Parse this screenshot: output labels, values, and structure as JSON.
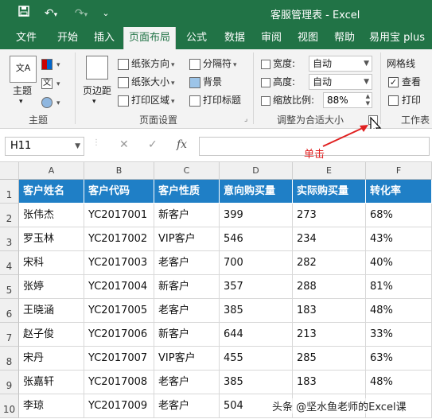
{
  "titlebar": {
    "save_icon": "save-icon",
    "undo_icon": "undo-icon",
    "redo_icon": "redo-icon",
    "title": "客服管理表 - Excel"
  },
  "tabs": [
    "文件",
    "开始",
    "插入",
    "页面布局",
    "公式",
    "数据",
    "审阅",
    "视图",
    "帮助",
    "易用宝 plus"
  ],
  "ribbon": {
    "theme_group": {
      "theme_label": "主题",
      "group_label": "主题"
    },
    "page_setup": {
      "margins_label": "页边距",
      "orientation_label": "纸张方向",
      "size_label": "纸张大小",
      "print_area_label": "打印区域",
      "breaks_label": "分隔符",
      "background_label": "背景",
      "print_titles_label": "打印标题",
      "group_label": "页面设置"
    },
    "scale_to_fit": {
      "width_label": "宽度:",
      "width_value": "自动",
      "height_label": "高度:",
      "height_value": "自动",
      "scale_label": "缩放比例:",
      "scale_value": "88%",
      "group_label": "调整为合适大小"
    },
    "sheet_options": {
      "gridlines_label": "网格线",
      "view_label": "查看",
      "view_checked": true,
      "print_label": "打印",
      "print_checked": false,
      "group_label": "工作表"
    }
  },
  "formula_bar": {
    "name_box": "H11",
    "fx": "fx",
    "cancel": "✕",
    "enter": "✓"
  },
  "annotation": "单击",
  "columns": [
    "A",
    "B",
    "C",
    "D",
    "E",
    "F"
  ],
  "headers": [
    "客户姓名",
    "客户代码",
    "客户性质",
    "意向购买量",
    "实际购买量",
    "转化率"
  ],
  "rows": [
    [
      "张伟杰",
      "YC2017001",
      "新客户",
      "399",
      "273",
      "68%"
    ],
    [
      "罗玉林",
      "YC2017002",
      "VIP客户",
      "546",
      "234",
      "43%"
    ],
    [
      "宋科",
      "YC2017003",
      "老客户",
      "700",
      "282",
      "40%"
    ],
    [
      "张婷",
      "YC2017004",
      "新客户",
      "357",
      "288",
      "81%"
    ],
    [
      "王晓涵",
      "YC2017005",
      "老客户",
      "385",
      "183",
      "48%"
    ],
    [
      "赵子俊",
      "YC2017006",
      "新客户",
      "644",
      "213",
      "33%"
    ],
    [
      "宋丹",
      "YC2017007",
      "VIP客户",
      "455",
      "285",
      "63%"
    ],
    [
      "张嘉轩",
      "YC2017008",
      "老客户",
      "385",
      "183",
      "48%"
    ],
    [
      "李琼",
      "YC2017009",
      "老客户",
      "504",
      "",
      ""
    ]
  ],
  "row_numbers": [
    "1",
    "2",
    "3",
    "4",
    "5",
    "6",
    "7",
    "8",
    "9",
    "10"
  ],
  "watermark": "头条 @坚水鱼老师的Excel课",
  "colors": {
    "excel_green": "#217346",
    "header_blue": "#1f7fc6",
    "annotation_red": "#e02020"
  }
}
